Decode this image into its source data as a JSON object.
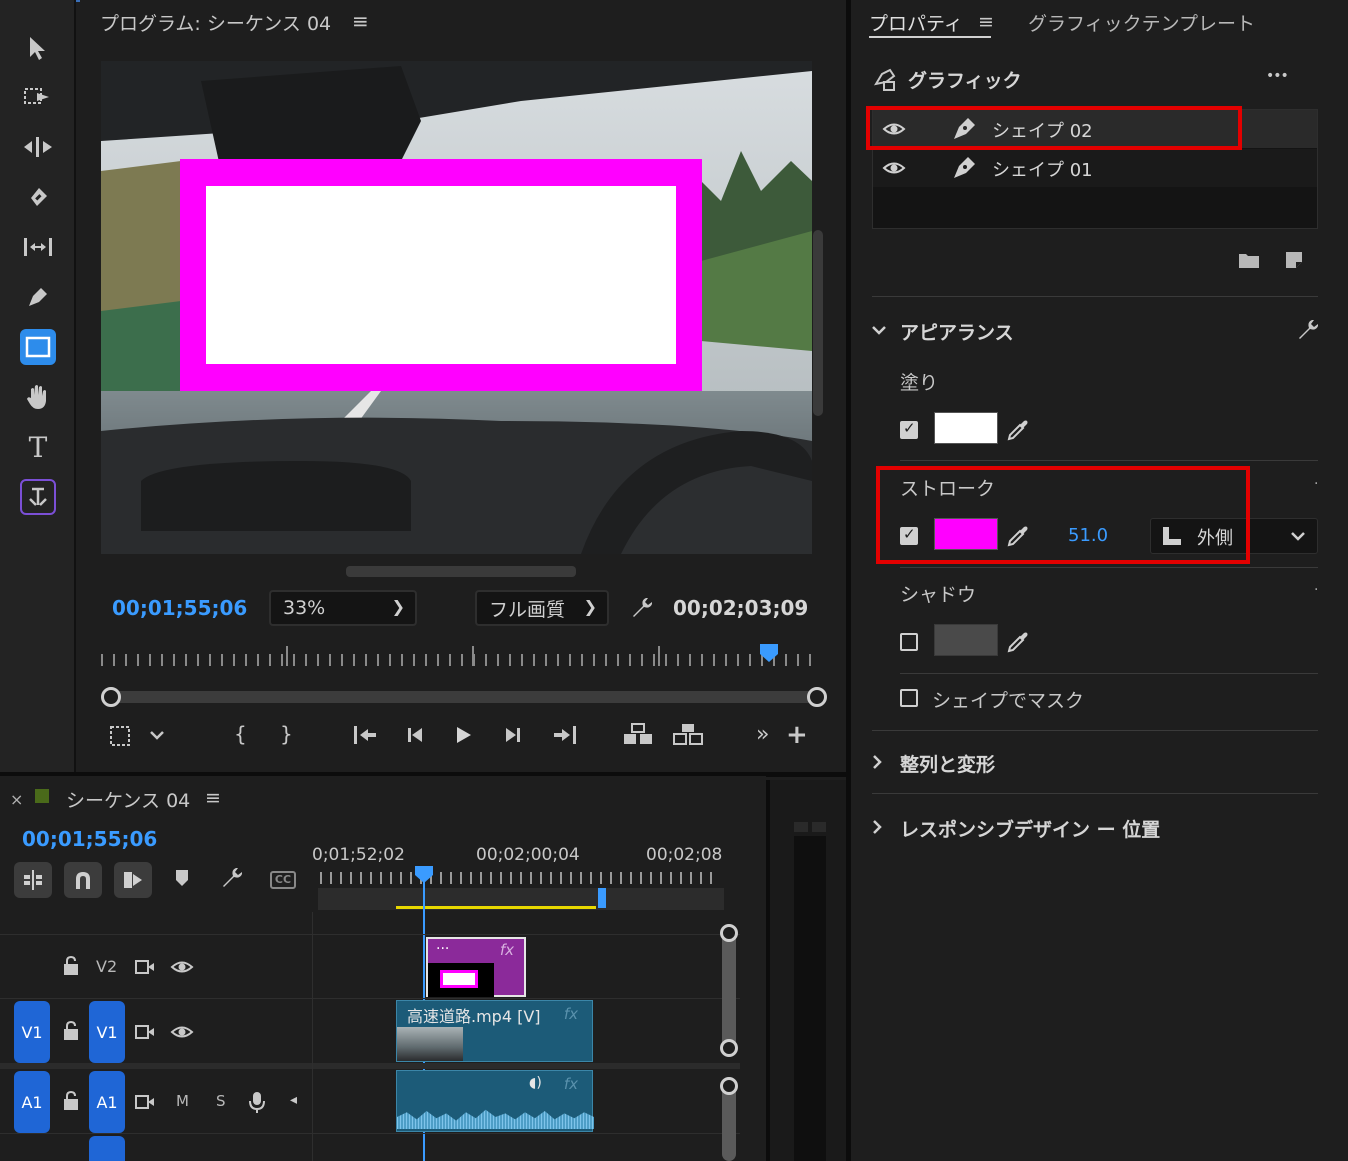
{
  "colors": {
    "accent": "#3a9bff",
    "stroke_color": "#ff00ff",
    "fill_color": "#ffffff",
    "shadow_color": "#4a4a4a",
    "highlight": "#e30000",
    "v2_clip": "#8b2a9a",
    "v1_clip": "#1c5b78"
  },
  "toolbar": {
    "tools": [
      "selection-tool-icon",
      "track-select-icon",
      "ripple-edit-icon",
      "razor-icon",
      "slip-icon",
      "pen-icon",
      "rectangle-icon",
      "hand-icon",
      "type-icon",
      "vertical-type-icon"
    ]
  },
  "program": {
    "title": "プログラム: シーケンス 04",
    "menu_icon": "≡",
    "current_time": "00;01;55;06",
    "zoom": "33%",
    "quality": "フル画質",
    "duration": "00;02;03;09"
  },
  "timeline": {
    "close": "×",
    "title": "シーケンス 04",
    "menu_icon": "≡",
    "current_time": "00;01;55;06",
    "ruler_labels": [
      "0;01;52;02",
      "00;02;00;04",
      "00;02;08"
    ],
    "tracks": {
      "v2": "V2",
      "v1_src": "V1",
      "v1": "V1",
      "a1_src": "A1",
      "a1": "A1",
      "m": "M",
      "s": "S"
    },
    "clips": {
      "v2_dots": "...",
      "v2_fx": "fx",
      "v1_name": "高速道路.mp4 [V]",
      "v1_fx": "fx",
      "a1_fx": "fx"
    }
  },
  "properties": {
    "tab_properties": "プロパティ",
    "tab_menu": "≡",
    "tab_graphic_template": "グラフィックテンプレート",
    "graphic_title": "グラフィック",
    "more": "•••",
    "layers": [
      "シェイプ 02",
      "シェイプ 01"
    ],
    "appearance": {
      "title": "アピアランス",
      "fill_label": "塗り",
      "fill_checked": true,
      "stroke_label": "ストローク",
      "stroke_checked": true,
      "stroke_width": "51.0",
      "stroke_position": "外側",
      "shadow_label": "シャドウ",
      "shadow_checked": false,
      "mask_label": "シェイプでマスク",
      "mask_checked": false
    },
    "align_transform": "整列と変形",
    "responsive": "レスポンシブデザイン ー 位置"
  }
}
